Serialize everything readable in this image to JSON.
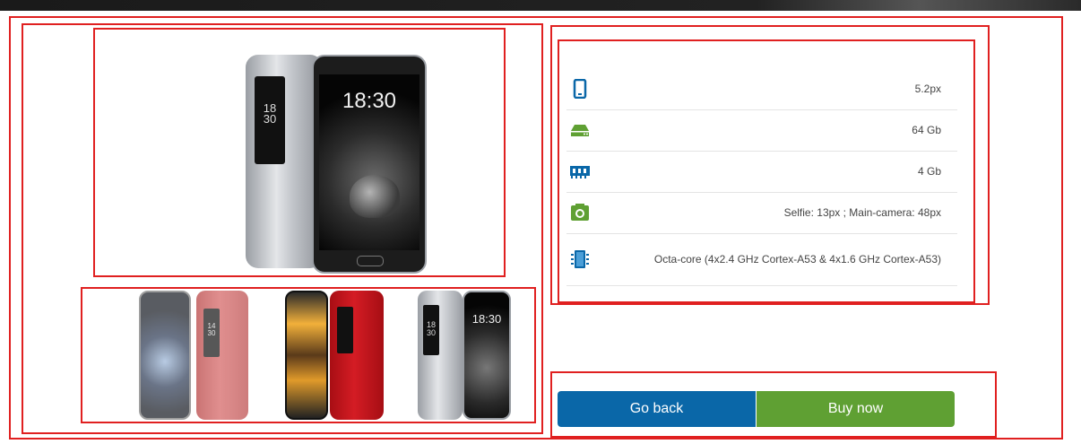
{
  "gallery": {
    "main_phone": {
      "rear_time": "18\n30",
      "front_time": "18:30",
      "accent": "#1c1c1c"
    },
    "thumbnails": [
      {
        "name": "thumbnail-1",
        "rear_time": "14\n30",
        "body_color": "#c94a4a"
      },
      {
        "name": "thumbnail-2",
        "body_color": "#c4141c"
      },
      {
        "name": "thumbnail-3",
        "rear_time": "18\n30",
        "front_time": "18:30",
        "body_color": "#bfc2c6"
      }
    ]
  },
  "specs": [
    {
      "icon": "smartphone-icon",
      "value": "5.2px"
    },
    {
      "icon": "storage-drive-icon",
      "value": "64 Gb"
    },
    {
      "icon": "memory-ram-icon",
      "value": "4 Gb"
    },
    {
      "icon": "camera-icon",
      "value": "Selfie: 13px ; Main-camera: 48px"
    },
    {
      "icon": "processor-chip-icon",
      "value": "Octa-core (4x2.4 GHz Cortex-A53 & 4x1.6 GHz Cortex-A53)"
    }
  ],
  "actions": {
    "back_label": "Go back",
    "buy_label": "Buy now"
  },
  "colors": {
    "primary_blue": "#0a67a8",
    "buy_green": "#5fa033",
    "annotation_red": "#e02020"
  }
}
